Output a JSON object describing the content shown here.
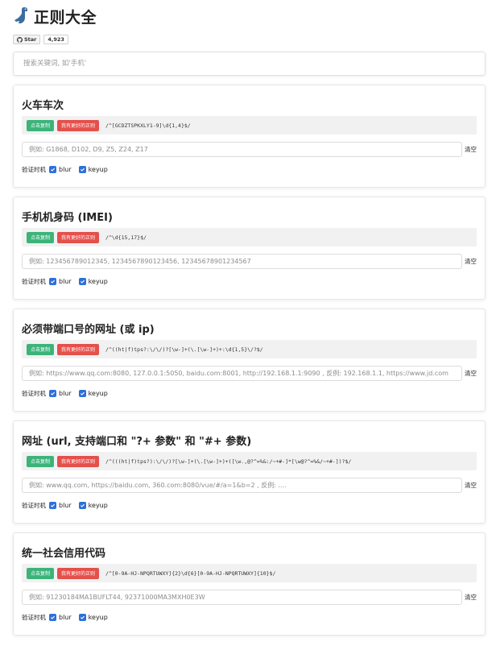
{
  "header": {
    "title": "正则大全",
    "github": {
      "star_label": "Star",
      "star_count": "4,923"
    }
  },
  "search": {
    "placeholder": "搜索关键词, 如'手机'"
  },
  "common": {
    "copy_label": "点击复制",
    "better_label": "我有更好的正则",
    "clear_label": "清空",
    "verify_label": "验证时机",
    "blur_label": "blur",
    "keyup_label": "keyup"
  },
  "cards": [
    {
      "title": "火车车次",
      "regex": "/^[GCDZTSPKXLY1-9]\\d{1,4}$/",
      "placeholder": "例如: G1868, D102, D9, Z5, Z24, Z17"
    },
    {
      "title": "手机机身码 (IMEI)",
      "regex": "/^\\d{15,17}$/",
      "placeholder": "例如: 123456789012345, 1234567890123456, 12345678901234567"
    },
    {
      "title": "必须带端口号的网址 (或 ip)",
      "regex": "/^((ht|f)tps?:\\/\\/)?[\\w-]+(\\.[\\w-]+)+:\\d{1,5}\\/?$/",
      "placeholder": "例如: https://www.qq.com:8080, 127.0.0.1:5050, baidu.com:8001, http://192.168.1.1:9090 , 反例: 192.168.1.1, https://www.jd.com"
    },
    {
      "title": "网址 (url, 支持端口和 \"?+ 参数\" 和 \"#+ 参数)",
      "regex": "/^(((ht|f)tps?):\\/\\/)?[\\w-]+(\\.[\\w-]+)+([\\w.,@?^=%&:/~+#-]*[\\w@?^=%&/~+#-])?$/",
      "placeholder": "例如: www.qq.com, https://baidu.com, 360.com:8080/vue/#/a=1&b=2 , 反例: ...."
    },
    {
      "title": "统一社会信用代码",
      "regex": "/^[0-9A-HJ-NPQRTUWXY]{2}\\d{6}[0-9A-HJ-NPQRTUWXY]{10}$/",
      "placeholder": "例如: 91230184MA1BUFLT44, 92371000MA3MXH0E3W"
    }
  ],
  "colors": {
    "copy_button": "#3cb37a",
    "better_button": "#e4504b",
    "checkbox": "#2e6fdb"
  },
  "icons": {
    "logo": "dinosaur-icon",
    "github": "github-icon",
    "checkbox": "check-icon"
  }
}
